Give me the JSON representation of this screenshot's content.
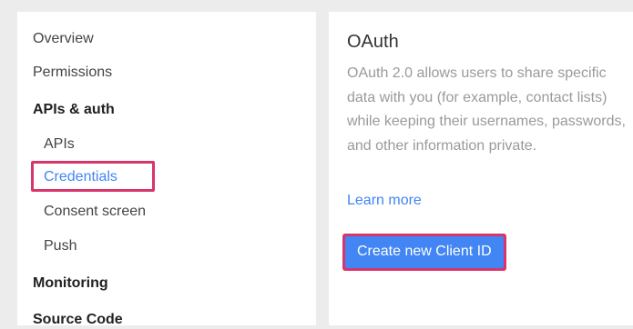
{
  "sidebar": {
    "items": [
      {
        "label": "Overview"
      },
      {
        "label": "Permissions"
      },
      {
        "label": "APIs & auth"
      },
      {
        "label": "APIs"
      },
      {
        "label": "Credentials"
      },
      {
        "label": "Consent screen"
      },
      {
        "label": "Push"
      },
      {
        "label": "Monitoring"
      },
      {
        "label": "Source Code"
      }
    ]
  },
  "main": {
    "title": "OAuth",
    "description": "OAuth 2.0 allows users to share specific data with you (for example, contact lists) while keeping their usernames, passwords, and other information private.",
    "learn_more": "Learn more",
    "create_button": "Create new Client ID"
  },
  "colors": {
    "accent": "#4285f4",
    "highlight": "#d8356a"
  }
}
